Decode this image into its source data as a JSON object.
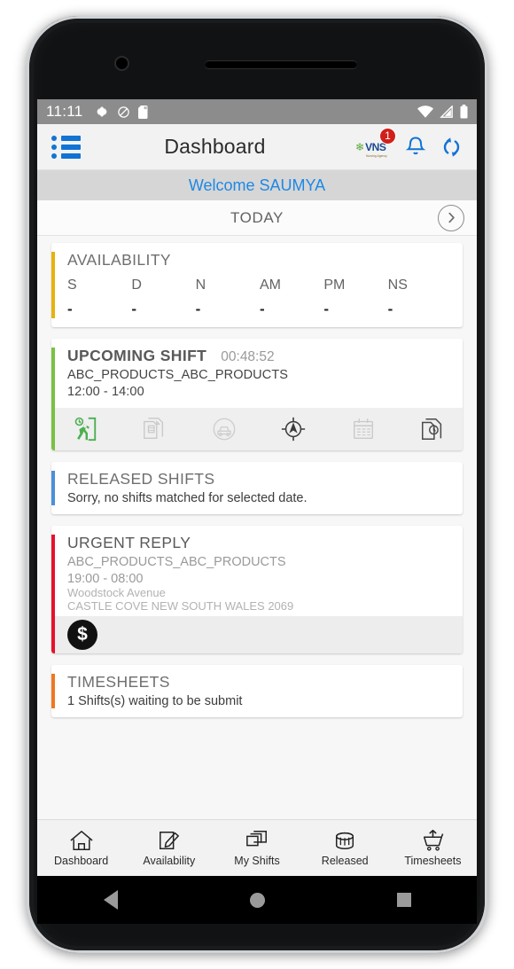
{
  "status_bar": {
    "time": "11:11",
    "left_icons": [
      "gear-icon",
      "mute-icon",
      "sd-card-icon"
    ],
    "right_icons": [
      "wifi-icon",
      "cell-signal-icon",
      "battery-icon"
    ]
  },
  "app_bar": {
    "menu_icon": "list-menu-icon",
    "title": "Dashboard",
    "logo_text": "VNS",
    "logo_tagline": "Nursing Agency",
    "notification_badge": "1",
    "bell_icon": "bell-icon",
    "refresh_icon": "sync-refresh-icon"
  },
  "welcome": {
    "text": "Welcome SAUMYA"
  },
  "date_bar": {
    "label": "TODAY",
    "next_icon": "chevron-right-circle-icon"
  },
  "cards": {
    "availability": {
      "title": "AVAILABILITY",
      "accent_color": "#e8b20e",
      "columns": [
        {
          "key": "S",
          "value": "-"
        },
        {
          "key": "D",
          "value": "-"
        },
        {
          "key": "N",
          "value": "-"
        },
        {
          "key": "AM",
          "value": "-"
        },
        {
          "key": "PM",
          "value": "-"
        },
        {
          "key": "NS",
          "value": "-"
        }
      ]
    },
    "upcoming_shift": {
      "title": "UPCOMING SHIFT",
      "accent_color": "#7ac143",
      "timer": "00:48:52",
      "client": "ABC_PRODUCTS_ABC_PRODUCTS",
      "time_range": "12:00 - 14:00",
      "actions": [
        "clock-in-person-icon",
        "documents-icon",
        "car-travel-icon",
        "navigate-compass-icon",
        "calendar-icon",
        "timesheet-clock-icon"
      ]
    },
    "released_shifts": {
      "title": "RELEASED SHIFTS",
      "accent_color": "#4a90d9",
      "message": "Sorry, no shifts matched for selected date."
    },
    "urgent_reply": {
      "title": "URGENT REPLY",
      "accent_color": "#e8112d",
      "client": "ABC_PRODUCTS_ABC_PRODUCTS",
      "time_range": "19:00 - 08:00",
      "address_line1": "Woodstock Avenue",
      "address_line2": "CASTLE COVE NEW SOUTH WALES 2069",
      "pay_icon": "dollar-badge-icon"
    },
    "timesheets": {
      "title": "TIMESHEETS",
      "accent_color": "#f07820",
      "message": "1 Shifts(s) waiting to be submit"
    }
  },
  "bottom_nav": [
    {
      "label": "Dashboard",
      "icon": "home-icon"
    },
    {
      "label": "Availability",
      "icon": "edit-square-icon"
    },
    {
      "label": "My Shifts",
      "icon": "layered-cards-icon"
    },
    {
      "label": "Released",
      "icon": "paint-bucket-icon"
    },
    {
      "label": "Timesheets",
      "icon": "cart-upload-icon"
    }
  ],
  "android_nav": {
    "back": "back-triangle-icon",
    "home": "home-circle-icon",
    "recents": "recents-square-icon"
  }
}
